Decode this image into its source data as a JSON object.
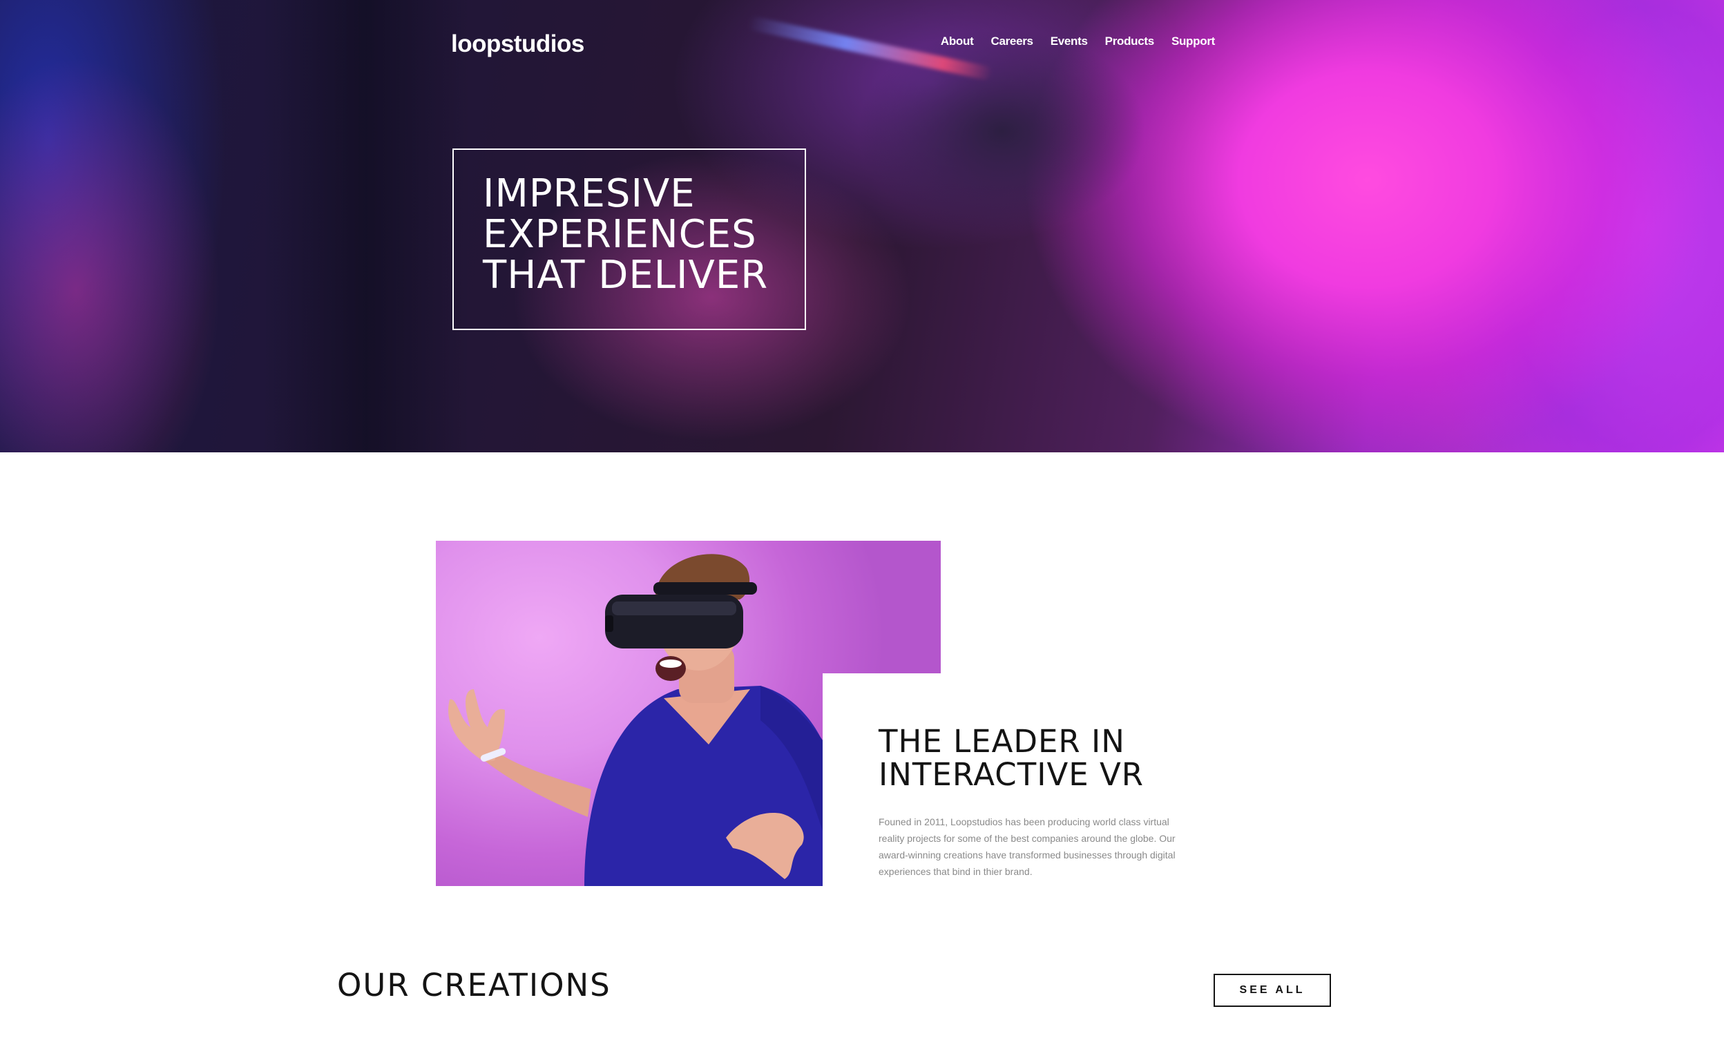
{
  "header": {
    "logo": "loopstudios",
    "nav": [
      {
        "label": "About"
      },
      {
        "label": "Careers"
      },
      {
        "label": "Events"
      },
      {
        "label": "Products"
      },
      {
        "label": "Support"
      }
    ]
  },
  "hero": {
    "headline": "IMPRESIVE\nEXPERIENCES\nTHAT DELIVER"
  },
  "interactive": {
    "title": "THE LEADER IN\nINTERACTIVE VR",
    "body": "Founed in 2011, Loopstudios has been producing world class virtual reality projects for some of the best companies around the globe. Our award-winning creations have transformed businesses through digital experiences that bind in thier brand."
  },
  "creations": {
    "title": "OUR CREATIONS",
    "button": "SEE ALL"
  },
  "colors": {
    "hero_accent": "#f03be0",
    "text_dark": "#141414",
    "text_muted": "#8a8a8a",
    "image_bg": "#df90ec"
  }
}
